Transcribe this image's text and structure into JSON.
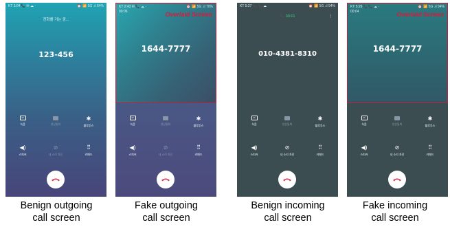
{
  "overlay_label": "Overlaid Screen",
  "panels": {
    "benign_outgoing": {
      "status_left": "KT 3:04 📞 ✉ ☁ ·",
      "status_right": "⏰ 📶 5G .ıl 64%",
      "calling_label": "전화를 거는 중...",
      "number": "123-456"
    },
    "fake_outgoing": {
      "status_left": "KT 2:43 ✉ 📞 ☁ ·",
      "status_right": "⏰ 📶 5G .ıl 70%",
      "timer": "00:06",
      "number": "1644-7777"
    },
    "benign_incoming": {
      "status_left": "KT 5:27 📞 📞 ☁",
      "status_right": "⏰ 📶 5G .ıl 94%",
      "duration": "📞 00:01",
      "number": "010-4381-8310"
    },
    "fake_incoming": {
      "status_left": "KT 5:26 📞 📞 ☁ ·",
      "status_right": "⏰ 📶 5G .ıl 94%",
      "timer": "00:04",
      "number": "1644-7777"
    }
  },
  "buttons": {
    "record": "녹음",
    "video": "영상통화",
    "bluetooth": "블루투스",
    "speaker": "스피커",
    "mute": "내 소리 차단",
    "keypad": "키패드"
  },
  "captions": {
    "benign_outgoing": [
      "Benign outgoing",
      "call screen"
    ],
    "fake_outgoing": [
      "Fake outgoing",
      "call screen"
    ],
    "benign_incoming": [
      "Benign incoming",
      "call screen"
    ],
    "fake_incoming": [
      "Fake incoming",
      "call screen"
    ]
  },
  "colors": {
    "overlay_border": "#c2203a",
    "end_call": "#e0304a",
    "duration_green": "#39d27a"
  }
}
